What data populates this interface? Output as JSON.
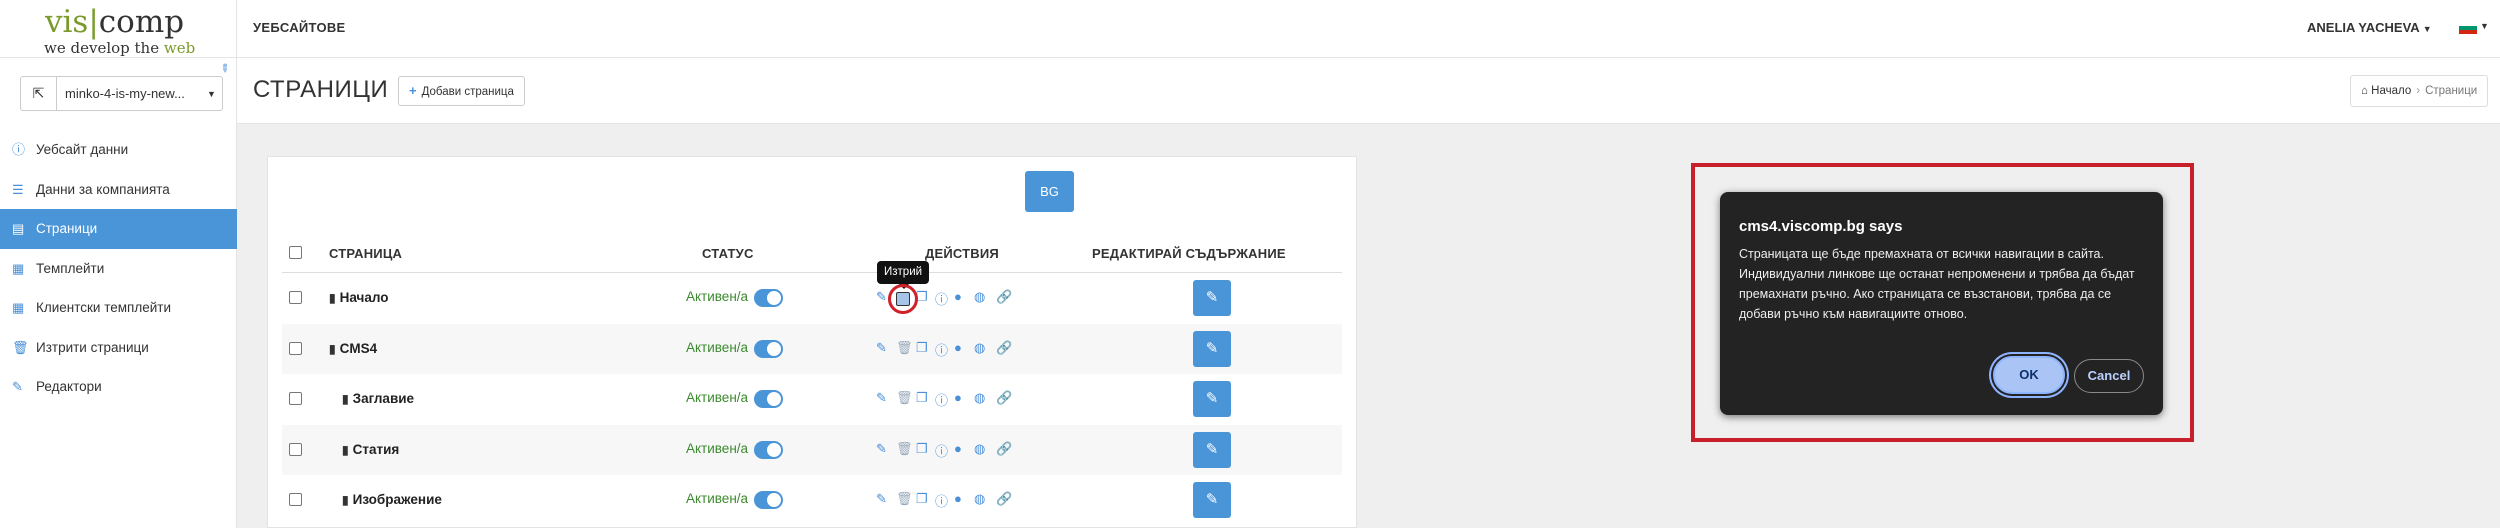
{
  "header": {
    "logo_vis": "vis",
    "logo_comp": "comp",
    "logo_tag_prefix": "we develop the ",
    "logo_tag_web": "web",
    "brand_title": "УЕБСАЙТОВЕ",
    "user_name": "ANELIA YACHEVA",
    "flag_colors": [
      "#ffffff",
      "#00966e",
      "#d62612"
    ]
  },
  "sidebar": {
    "site_selector_value": "minko-4-is-my-new...",
    "items": [
      {
        "label": "Уебсайт данни",
        "icon": "info-circle-icon",
        "glyph": "ⓘ"
      },
      {
        "label": "Данни за компанията",
        "icon": "list-icon",
        "glyph": "☰"
      },
      {
        "label": "Страници",
        "icon": "pages-icon",
        "glyph": "▤"
      },
      {
        "label": "Темплейти",
        "icon": "grid-icon",
        "glyph": "▦"
      },
      {
        "label": "Клиентски темплейти",
        "icon": "grid-icon",
        "glyph": "▦"
      },
      {
        "label": "Изтрити страници",
        "icon": "trash-icon",
        "glyph": "🗑"
      },
      {
        "label": "Редактори",
        "icon": "pencil-icon",
        "glyph": "✎"
      }
    ],
    "active_index": 2
  },
  "page": {
    "title": "СТРАНИЦИ",
    "add_button": "Добави страница",
    "breadcrumb_home": "Начало",
    "breadcrumb_current": "Страници"
  },
  "table": {
    "lang_button": "BG",
    "columns": {
      "page": "СТРАНИЦА",
      "status": "СТАТУС",
      "actions": "ДЕЙСТВИЯ",
      "edit_content": "РЕДАКТИРАЙ СЪДЪРЖАНИЕ"
    },
    "rows": [
      {
        "name": "Начало",
        "status": "Активен/а",
        "indent": 0
      },
      {
        "name": "CMS4",
        "status": "Активен/а",
        "indent": 0
      },
      {
        "name": "Заглавие",
        "status": "Активен/а",
        "indent": 1
      },
      {
        "name": "Статия",
        "status": "Активен/а",
        "indent": 1
      },
      {
        "name": "Изображение",
        "status": "Активен/а",
        "indent": 1
      }
    ],
    "delete_tooltip": "Изтрий"
  },
  "dialog": {
    "title": "cms4.viscomp.bg says",
    "message": "Страницата ще бъде премахната от всички навигации в сайта. Индивидуални линкове ще останат непроменени и трябва да бъдат премахнати ръчно. Ако страницата се възстанови, трябва да се добави ръчно към навигациите отново.",
    "ok_label": "OK",
    "cancel_label": "Cancel"
  }
}
